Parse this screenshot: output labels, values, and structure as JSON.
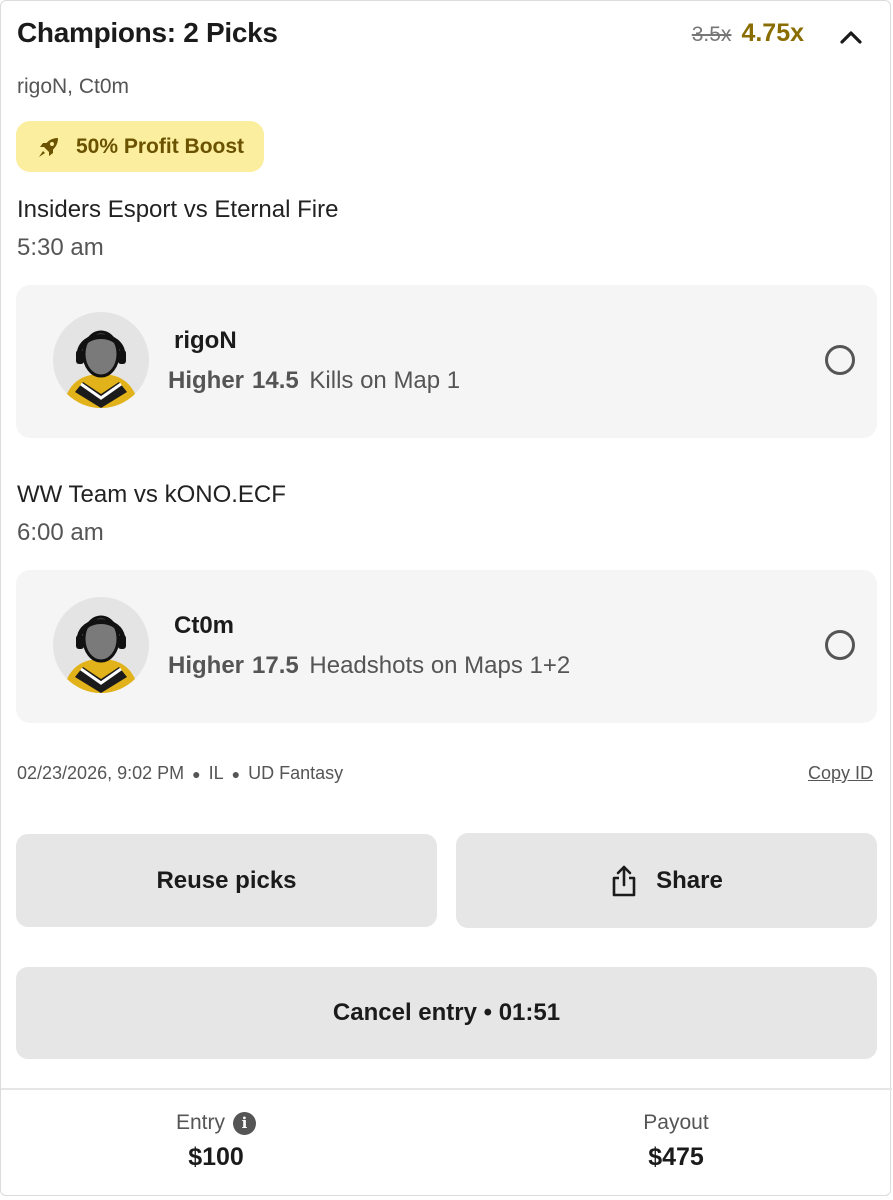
{
  "header": {
    "title": "Champions: 2 Picks",
    "old_multiplier": "3.5x",
    "new_multiplier": "4.75x",
    "collapse_icon": "chevron-up-icon"
  },
  "players_summary": "rigoN, Ct0m",
  "boost": {
    "icon": "rocket-icon",
    "label": "50% Profit Boost",
    "color": "#fbef9f"
  },
  "picks": [
    {
      "match": "Insiders Esport vs Eternal Fire",
      "time": "5:30 am",
      "player": "rigoN",
      "direction": "Higher",
      "value": "14.5",
      "stat": "Kills on Map 1"
    },
    {
      "match": "WW Team vs kONO.ECF",
      "time": "6:00 am",
      "player": "Ct0m",
      "direction": "Higher",
      "value": "17.5",
      "stat": "Headshots on Maps 1+2"
    }
  ],
  "meta": {
    "datetime": "02/23/2026, 9:02 PM",
    "state": "IL",
    "brand": "UD Fantasy",
    "copy_id": "Copy ID"
  },
  "actions": {
    "reuse": "Reuse picks",
    "share": "Share",
    "cancel": "Cancel entry • 01:51"
  },
  "footer": {
    "entry_label": "Entry",
    "entry_value": "$100",
    "payout_label": "Payout",
    "payout_value": "$475"
  },
  "colors": {
    "accent_gold": "#8a6d00",
    "avatar_jersey": "#e2b21a"
  }
}
